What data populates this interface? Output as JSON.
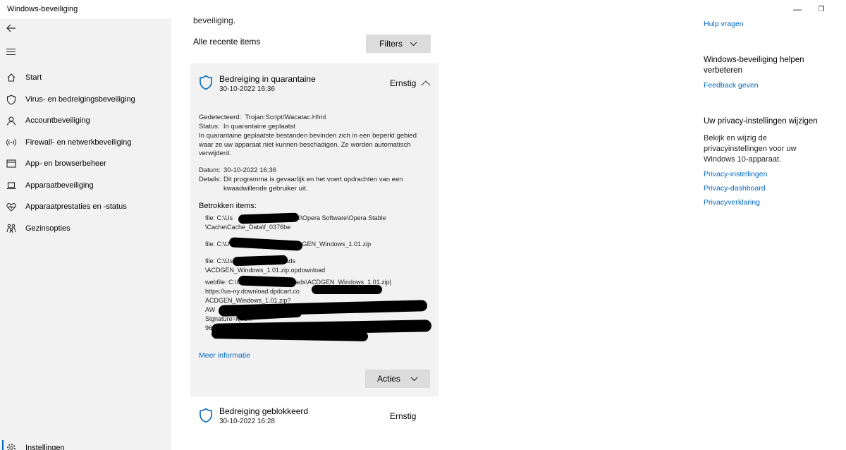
{
  "window": {
    "title": "Windows-beveiliging",
    "minimize": "—",
    "restore": "❐"
  },
  "sidebar": {
    "items": [
      {
        "label": "Start",
        "icon": "home-icon"
      },
      {
        "label": "Virus- en bedreigingsbeveiliging",
        "icon": "shield-icon"
      },
      {
        "label": "Accountbeveiliging",
        "icon": "person-icon"
      },
      {
        "label": "Firewall- en netwerkbeveiliging",
        "icon": "wifi-icon"
      },
      {
        "label": "App- en browserbeheer",
        "icon": "app-window-icon"
      },
      {
        "label": "Apparaatbeveiliging",
        "icon": "laptop-icon"
      },
      {
        "label": "Apparaatprestaties en -status",
        "icon": "heart-icon"
      },
      {
        "label": "Gezinsopties",
        "icon": "family-icon"
      }
    ],
    "settings": {
      "label": "Instellingen",
      "icon": "gear-icon"
    }
  },
  "main": {
    "intro_tail": "beveiliging.",
    "section_label": "Alle recente items",
    "filters_label": "Filters"
  },
  "threat": {
    "title": "Bedreiging in quarantaine",
    "date": "30-10-2022 16:36",
    "severity": "Ernstig",
    "detected_label": "Gedetecteerd:",
    "detected_value": "Trojan:Script/Wacatac.H!ml",
    "status_label": "Status:",
    "status_value": "In quarantaine geplaatst",
    "status_desc": "In quarantaine geplaatste bestanden bevinden zich in een beperkt gebied waar ze uw apparaat niet kunnen beschadigen. Ze worden automatisch verwijderd.",
    "datum_label": "Datum:",
    "datum_value": "30-10-2022 16:36",
    "details_label": "Details:",
    "details_value": "Dit programma is gevaarlijk en het voert opdrachten van een kwaadwillende gebruiker uit.",
    "affected_title": "Betrokken items:",
    "files": {
      "f1a": "file: C:\\Us                              Local\\Opera Software\\Opera Stable",
      "f1b": "\\Cache\\Cache_Data\\f_0376be",
      "f2": "file: C:\\U                              ls\\ACDGEN_Windows_1.01.zip",
      "f3a": "file: C:\\Us                         nloads",
      "f3b": "\\ACDGEN_Windows_1.01.zip.opdownload",
      "w1": "webfile: C:\\U                          nloads\\ACDGEN_Windows_1.01.zip|",
      "w2": "https://us-ny.download.dpdcart.co",
      "w3": "ACDGEN_Windows_1.01.zip?",
      "w4": "AW",
      "w5": "Signature=kj0zM",
      "w6": "963D&e"
    },
    "more_link": "Meer informatie",
    "actions_label": "Acties"
  },
  "threat2": {
    "title": "Bedreiging geblokkeerd",
    "date": "30-10-2022 16:28",
    "severity": "Ernstig"
  },
  "right": {
    "help_link": "Hulp vragen",
    "improve_heading": "Windows-beveiliging helpen verbeteren",
    "feedback_link": "Feedback geven",
    "privacy_heading": "Uw privacy-instellingen wijzigen",
    "privacy_text": "Bekijk en wijzig de privacyinstellingen voor uw Windows 10-apparaat.",
    "privacy_settings_link": "Privacy-instellingen",
    "privacy_dashboard_link": "Privacy-dashboard",
    "privacy_statement_link": "Privacyverklaring"
  },
  "colors": {
    "accent": "#0067c0",
    "sidebar_bg": "#f2f2f2",
    "card_bg": "#f2f2f2",
    "button_bg": "#dcdcdc",
    "redaction": "#000000"
  }
}
